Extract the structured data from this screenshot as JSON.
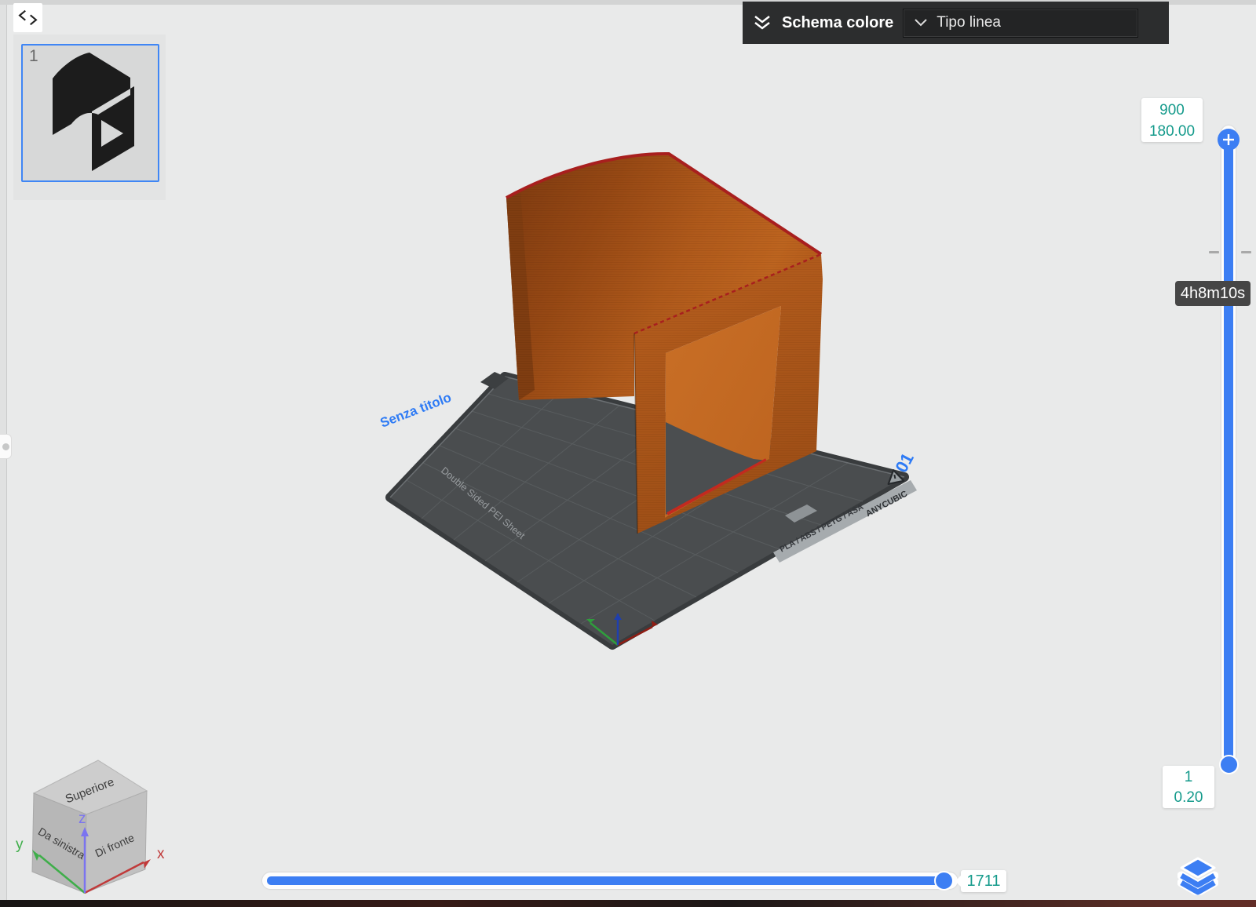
{
  "toolbar": {
    "color_scheme_label": "Schema colore",
    "line_type_label": "Tipo linea"
  },
  "objects": {
    "thumbnail_index": "1"
  },
  "plate": {
    "name": "Senza titolo",
    "number": "01",
    "sheet_label": "Double Sided PEI Sheet",
    "materials": "PLA / ABS / PETG / ASA",
    "brand": "ANYCUBIC"
  },
  "layer_slider": {
    "top_layer": "900",
    "top_height": "180.00",
    "print_time": "4h8m10s",
    "bottom_layer": "1",
    "bottom_height": "0.20"
  },
  "move_slider": {
    "value": "1711"
  },
  "view_cube": {
    "top": "Superiore",
    "left": "Da sinistra",
    "front": "Di fronte",
    "axis_x": "x",
    "axis_y": "y",
    "axis_z": "z"
  },
  "colors": {
    "accent_blue": "#3c7ef3",
    "value_teal": "#149a8b",
    "model_orange": "#b05a1b",
    "top_layer_red": "#a81f1e",
    "label_blue": "#2e7bf5"
  }
}
